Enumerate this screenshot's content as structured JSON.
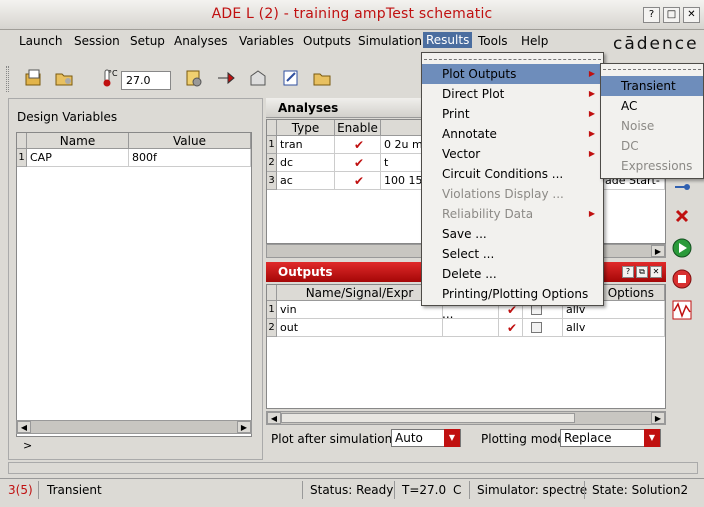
{
  "window": {
    "title": "ADE L (2) - training ampTest schematic",
    "buttons": [
      "?",
      "□",
      "✕"
    ]
  },
  "menubar": {
    "items": [
      "Launch",
      "Session",
      "Setup",
      "Analyses",
      "Variables",
      "Outputs",
      "Simulation",
      "Results",
      "Tools",
      "Help"
    ],
    "active": "Results",
    "brand": "cādence"
  },
  "toolbar": {
    "temperature_value": "27.0",
    "temperature_label": "°C"
  },
  "design_variables": {
    "title": "Design Variables",
    "columns": [
      "Name",
      "Value"
    ],
    "rows": [
      {
        "num": "1",
        "name": "CAP",
        "value": "800f"
      }
    ],
    "prompt": ">"
  },
  "analyses": {
    "title": "Analyses",
    "columns": [
      "Type",
      "Enable"
    ],
    "rows": [
      {
        "num": "1",
        "type": "tran",
        "args": "0 2u m"
      },
      {
        "num": "2",
        "type": "dc",
        "args": "t"
      },
      {
        "num": "3",
        "type": "ac",
        "args": "100 15"
      }
    ],
    "overflow_text": "ade Start-"
  },
  "outputs": {
    "title": "Outputs",
    "columns": [
      "Name/Signal/Expr",
      "Options"
    ],
    "rows": [
      {
        "num": "1",
        "name": "vin",
        "options": "allv"
      },
      {
        "num": "2",
        "name": "out",
        "options": "allv"
      }
    ],
    "plot_after_label": "Plot after simulation:",
    "plot_after_value": "Auto",
    "plotting_mode_label": "Plotting mode:",
    "plotting_mode_value": "Replace"
  },
  "results_menu": {
    "items": [
      {
        "label": "Plot Outputs",
        "disabled": false,
        "submenu": true,
        "highlight": true
      },
      {
        "label": "Direct Plot",
        "disabled": false,
        "submenu": true
      },
      {
        "label": "Print",
        "disabled": false,
        "submenu": true
      },
      {
        "label": "Annotate",
        "disabled": false,
        "submenu": true
      },
      {
        "label": "Vector",
        "disabled": false,
        "submenu": true
      },
      {
        "label": "Circuit Conditions ...",
        "disabled": false,
        "submenu": false
      },
      {
        "label": "Violations Display ...",
        "disabled": true,
        "submenu": false
      },
      {
        "label": "Reliability Data",
        "disabled": true,
        "submenu": true
      },
      {
        "label": "Save ...",
        "disabled": false,
        "submenu": false
      },
      {
        "label": "Select ...",
        "disabled": false,
        "submenu": false
      },
      {
        "label": "Delete ...",
        "disabled": false,
        "submenu": false
      },
      {
        "label": "Printing/Plotting Options ...",
        "disabled": false,
        "submenu": false
      }
    ]
  },
  "plot_outputs_submenu": {
    "items": [
      {
        "label": "Transient",
        "disabled": false,
        "highlight": true
      },
      {
        "label": "AC",
        "disabled": false
      },
      {
        "label": "Noise",
        "disabled": true
      },
      {
        "label": "DC",
        "disabled": true
      },
      {
        "label": "Expressions",
        "disabled": true
      }
    ]
  },
  "statusbar": {
    "counter": "3(5)",
    "mode": "Transient",
    "status": "Status: Ready",
    "temp": "T=27.0",
    "temp_unit": "C",
    "simulator": "Simulator: spectre",
    "state": "State: Solution2"
  },
  "colors": {
    "accent_red": "#c01010",
    "menu_highlight": "#6e8dbb",
    "panel_header_red": "#c41616"
  }
}
